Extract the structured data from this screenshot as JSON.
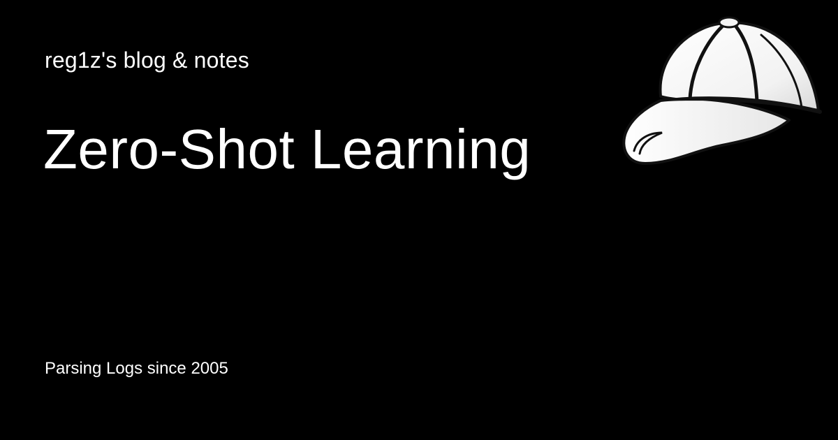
{
  "header": {
    "site_name": "reg1z's blog & notes"
  },
  "post": {
    "title": "Zero-Shot Learning"
  },
  "footer": {
    "tagline": "Parsing Logs since 2005"
  },
  "logo": {
    "icon": "baseball-cap-icon"
  },
  "colors": {
    "background": "#000000",
    "text": "#ffffff",
    "cap_fill": "#f7f7f7",
    "cap_outline": "#111111"
  }
}
